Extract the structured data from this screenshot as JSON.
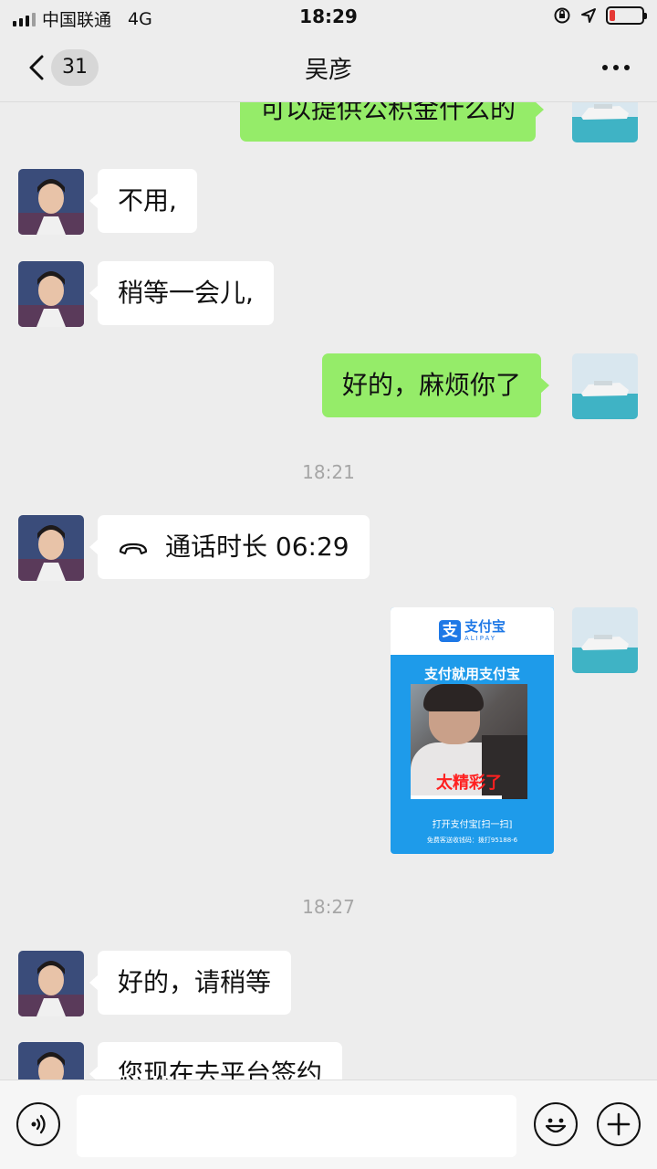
{
  "status_bar": {
    "carrier": "中国联通",
    "network": "4G",
    "time": "18:29",
    "battery_level": 0.18
  },
  "nav": {
    "unread_count": "31",
    "title": "吴彦"
  },
  "messages": {
    "m0": "可以提供公积金什么的",
    "m1": "不用,",
    "m2": "稍等一会儿,",
    "m3": "好的，麻烦你了",
    "ts1": "18:21",
    "call": "通话时长 06:29",
    "ts2": "18:27",
    "m5": "好的，请稍等",
    "m6": "您现在去平台签约"
  },
  "alipay_image": {
    "logo_char": "支",
    "brand": "支付宝",
    "brand_en": "ALIPAY",
    "slogan": "支付就用支付宝",
    "caption": "太精彩了",
    "open_text": "打开支付宝[扫一扫]",
    "small_text": "免费客送收钱码：拨打95188-6"
  },
  "colors": {
    "outgoing_bubble": "#95ec69",
    "incoming_bubble": "#ffffff",
    "background": "#ededed",
    "alipay_blue": "#1e9bea"
  }
}
